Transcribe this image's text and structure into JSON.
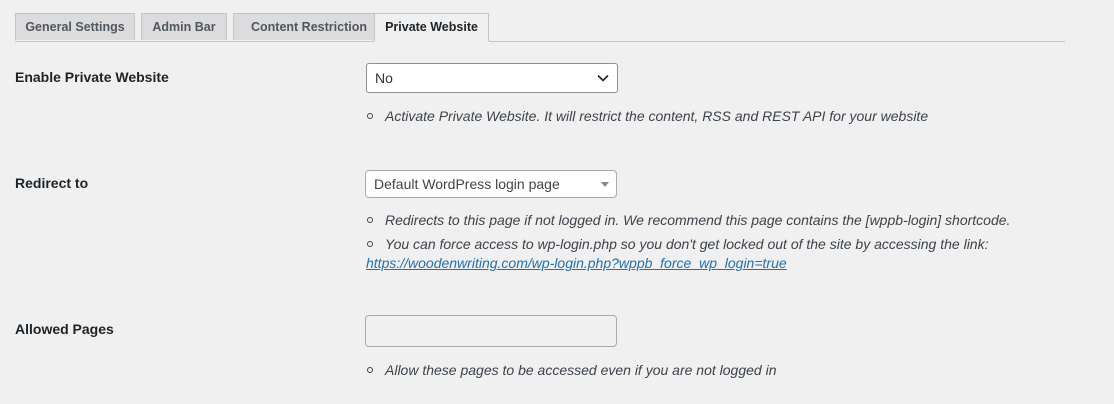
{
  "tabs": [
    {
      "label": "General Settings",
      "active": false
    },
    {
      "label": "Admin Bar",
      "active": false
    },
    {
      "label": "Content Restriction",
      "active": false
    },
    {
      "label": "Private Website",
      "active": true
    }
  ],
  "enable_private": {
    "label": "Enable Private Website",
    "value": "No",
    "description": "Activate Private Website. It will restrict the content, RSS and REST API for your website"
  },
  "redirect": {
    "label": "Redirect to",
    "value": "Default WordPress login page",
    "description_1": "Redirects to this page if not logged in. We recommend this page contains the [wppb-login] shortcode.",
    "description_2": "You can force access to wp-login.php so you don't get locked out of the site by accessing the link:",
    "link": "https://woodenwriting.com/wp-login.php?wppb_force_wp_login=true"
  },
  "allowed_pages": {
    "label": "Allowed Pages",
    "value": "",
    "description": "Allow these pages to be accessed even if you are not logged in"
  },
  "colors": {
    "background": "#f0f0f1",
    "link": "#2271b1",
    "text": "#1d2327"
  },
  "icons": {
    "select_chevron": "chevron-down-icon",
    "select2_arrow": "caret-down-icon",
    "bullet": "hollow-circle-bullet-icon"
  }
}
